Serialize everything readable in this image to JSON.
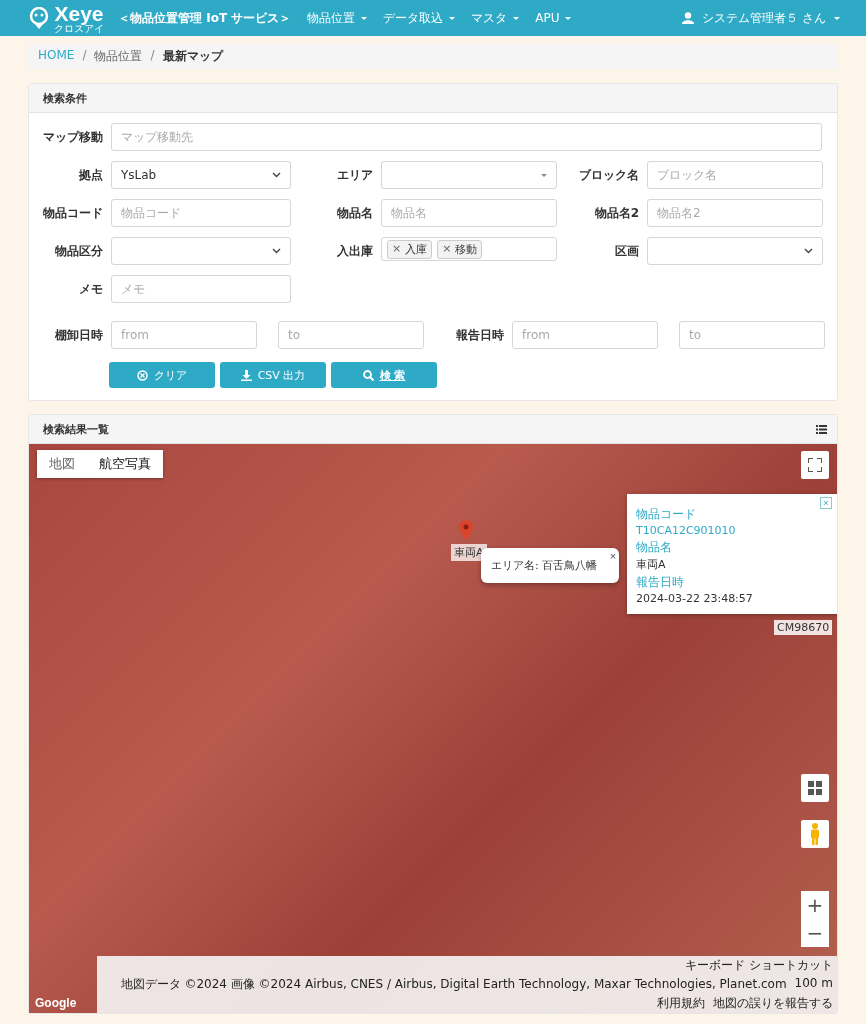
{
  "header": {
    "logo": "Xeye",
    "logo_sub": "クロスアイ",
    "service": "＜物品位置管理 IoT サービス＞",
    "nav": [
      {
        "label": "物品位置"
      },
      {
        "label": "データ取込"
      },
      {
        "label": "マスタ"
      },
      {
        "label": "APU"
      }
    ],
    "user": "システム管理者５ さん"
  },
  "breadcrumb_separator": "/",
  "breadcrumb": [
    {
      "label": "HOME",
      "kind": "link"
    },
    {
      "label": "物品位置",
      "kind": "text"
    },
    {
      "label": "最新マップ",
      "kind": "current"
    }
  ],
  "search_panel": {
    "title": "検索条件",
    "map_move": {
      "label": "マップ移動",
      "placeholder": "マップ移動先"
    },
    "fields": [
      {
        "label": "拠点",
        "kind": "select",
        "value": "YsLab"
      },
      {
        "label": "エリア",
        "kind": "combo"
      },
      {
        "label": "ブロック名",
        "kind": "input",
        "placeholder": "ブロック名"
      },
      {
        "label": "物品コード",
        "kind": "input",
        "placeholder": "物品コード"
      },
      {
        "label": "物品名",
        "kind": "input",
        "placeholder": "物品名"
      },
      {
        "label": "物品名2",
        "kind": "input",
        "placeholder": "物品名2"
      },
      {
        "label": "物品区分",
        "kind": "select"
      },
      {
        "label": "入出庫",
        "kind": "tags",
        "tags": [
          "入庫",
          "移動"
        ],
        "tag_remove": "×"
      },
      {
        "label": "区画",
        "kind": "select"
      },
      {
        "label": "メモ",
        "kind": "input",
        "placeholder": "メモ"
      }
    ],
    "date_ranges": [
      {
        "label": "棚卸日時",
        "from": {
          "placeholder": "from"
        },
        "to": {
          "placeholder": "to"
        }
      },
      {
        "label": "報告日時",
        "from": {
          "placeholder": "from"
        },
        "to": {
          "placeholder": "to"
        }
      }
    ],
    "buttons": [
      {
        "label": "クリア",
        "kind": "clear"
      },
      {
        "label": "CSV 出力",
        "kind": "download"
      },
      {
        "label": "検 索",
        "kind": "search"
      }
    ]
  },
  "results_panel": {
    "title": "検索結果一覧",
    "map": {
      "map_types": [
        {
          "label": "地図",
          "selected": false
        },
        {
          "label": "航空写真",
          "selected": true
        }
      ],
      "marker_labels": [
        "車両A",
        "CM98670"
      ],
      "area_popup": {
        "text": "エリア名: 百舌鳥八幡",
        "close": "×"
      },
      "info_window": {
        "close": "×",
        "fields": [
          {
            "label": "物品コード",
            "value": "T10CA12C901010",
            "kind": "link"
          },
          {
            "label": "物品名",
            "value": "車両A",
            "kind": "text"
          },
          {
            "label": "報告日時",
            "value": "2024-03-22 23:48:57",
            "kind": "text"
          }
        ]
      },
      "zoom_in": "+",
      "zoom_out": "−",
      "google": "Google",
      "attribution": [
        "キーボード ショートカット",
        "地図データ ©2024 画像 ©2024 Airbus, CNES / Airbus, Digital Earth Technology, Maxar Technologies, Planet.com",
        "100 m",
        "利用規約",
        "地図の誤りを報告する"
      ]
    }
  }
}
